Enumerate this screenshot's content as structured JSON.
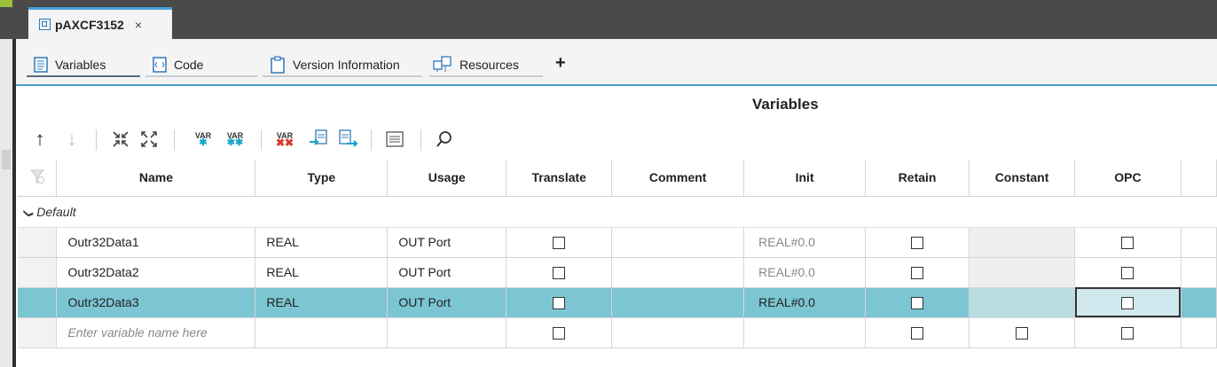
{
  "document_tab": {
    "title": "pAXCF3152",
    "close": "×",
    "icon": "module-icon"
  },
  "editor_tabs": [
    {
      "label": "Variables",
      "icon": "variables-icon"
    },
    {
      "label": "Code",
      "icon": "code-icon"
    },
    {
      "label": "Version Information",
      "icon": "clipboard-icon"
    },
    {
      "label": "Resources",
      "icon": "resources-icon"
    }
  ],
  "add_tab": "+",
  "section_title": "Variables",
  "toolbar": {
    "move_up": "↑",
    "move_down": "↓",
    "var_label": "VAR"
  },
  "columns": [
    "Name",
    "Type",
    "Usage",
    "Translate",
    "Comment",
    "Init",
    "Retain",
    "Constant",
    "OPC"
  ],
  "group": {
    "label": "Default",
    "expanded": true
  },
  "rows": [
    {
      "name": "Outr32Data1",
      "type": "REAL",
      "usage": "OUT Port",
      "init": "REAL#0.0"
    },
    {
      "name": "Outr32Data2",
      "type": "REAL",
      "usage": "OUT Port",
      "init": "REAL#0.0"
    },
    {
      "name": "Outr32Data3",
      "type": "REAL",
      "usage": "OUT Port",
      "init": "REAL#0.0",
      "selected": true
    }
  ],
  "new_row_placeholder": "Enter variable name here",
  "colors": {
    "accent": "#4a9fd6",
    "selection": "#7cc5d2"
  }
}
